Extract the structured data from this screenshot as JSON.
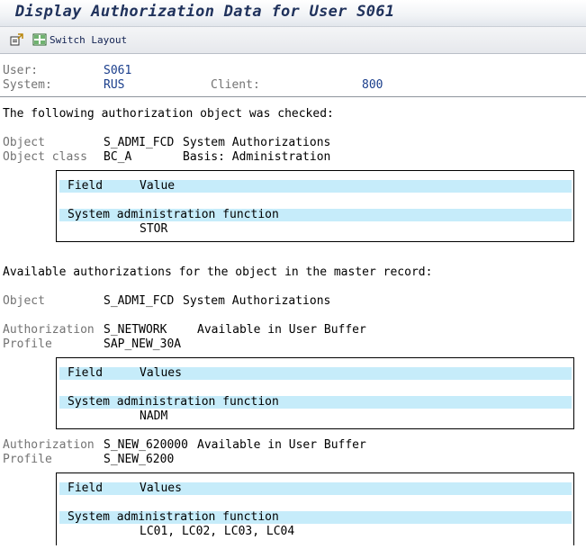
{
  "window": {
    "title": "Display Authorization Data for User S061"
  },
  "toolbar": {
    "switch_layout_label": "Switch Layout"
  },
  "header": {
    "user_label": "User:",
    "user_value": "S061",
    "system_label": "System:",
    "system_value": "RUS",
    "client_label": "Client:",
    "client_value": "800"
  },
  "checked": {
    "intro": "The following authorization object was checked:",
    "object_label": "Object",
    "object_value": "S_ADMI_FCD",
    "object_desc": "System Authorizations",
    "class_label": "Object class",
    "class_value": "BC_A",
    "class_desc": "Basis: Administration",
    "table": {
      "col_field": "Field",
      "col_value": "Value",
      "field_name": "System administration function",
      "field_value": "STOR"
    }
  },
  "available": {
    "intro": "Available authorizations for the object in the master record:",
    "object_label": "Object",
    "object_value": "S_ADMI_FCD",
    "object_desc": "System Authorizations",
    "auths": [
      {
        "auth_label": "Authorization",
        "auth_value": "S_NETWORK",
        "auth_status": "Available in User Buffer",
        "profile_label": "Profile",
        "profile_value": "SAP_NEW_30A",
        "col_field": "Field",
        "col_values": "Values",
        "field_name": "System administration function",
        "field_values": "NADM"
      },
      {
        "auth_label": "Authorization",
        "auth_value": "S_NEW_620000",
        "auth_status": "Available in User Buffer",
        "profile_label": "Profile",
        "profile_value": "S_NEW_6200",
        "col_field": "Field",
        "col_values": "Values",
        "field_name": "System administration function",
        "field_values": "LC01, LC02, LC03, LC04"
      }
    ]
  },
  "colors": {
    "title": "#20325c",
    "row_highlight": "#c6ecfa",
    "label_grey": "#737373",
    "value_blue": "#1a3e8c"
  }
}
